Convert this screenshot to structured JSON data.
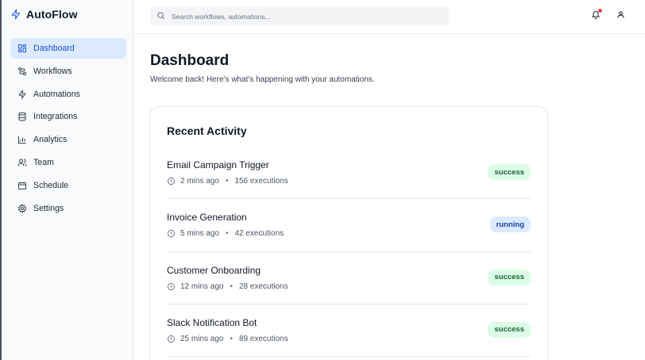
{
  "brand": {
    "name": "AutoFlow",
    "icon": "lightning-icon",
    "accent": "#2563eb"
  },
  "sidebar": {
    "items": [
      {
        "label": "Dashboard",
        "icon": "grid-icon",
        "active": true
      },
      {
        "label": "Workflows",
        "icon": "workflow-icon",
        "active": false
      },
      {
        "label": "Automations",
        "icon": "lightning-icon",
        "active": false
      },
      {
        "label": "Integrations",
        "icon": "database-icon",
        "active": false
      },
      {
        "label": "Analytics",
        "icon": "bar-chart-icon",
        "active": false
      },
      {
        "label": "Team",
        "icon": "users-icon",
        "active": false
      },
      {
        "label": "Schedule",
        "icon": "calendar-icon",
        "active": false
      },
      {
        "label": "Settings",
        "icon": "gear-icon",
        "active": false
      }
    ]
  },
  "topbar": {
    "search_placeholder": "Search workflows, automations...",
    "notification_badge_color": "#ef4444"
  },
  "main": {
    "title": "Dashboard",
    "subtitle": "Welcome back! Here's what's happening with your automations."
  },
  "activity": {
    "title": "Recent Activity",
    "items": [
      {
        "name": "Email Campaign Trigger",
        "time": "2 mins ago",
        "executions": "156 executions",
        "status": "success"
      },
      {
        "name": "Invoice Generation",
        "time": "5 mins ago",
        "executions": "42 executions",
        "status": "running"
      },
      {
        "name": "Customer Onboarding",
        "time": "12 mins ago",
        "executions": "28 executions",
        "status": "success"
      },
      {
        "name": "Slack Notification Bot",
        "time": "25 mins ago",
        "executions": "89 executions",
        "status": "success"
      }
    ]
  },
  "status_colors": {
    "success": "#166534",
    "running": "#1e40af"
  }
}
